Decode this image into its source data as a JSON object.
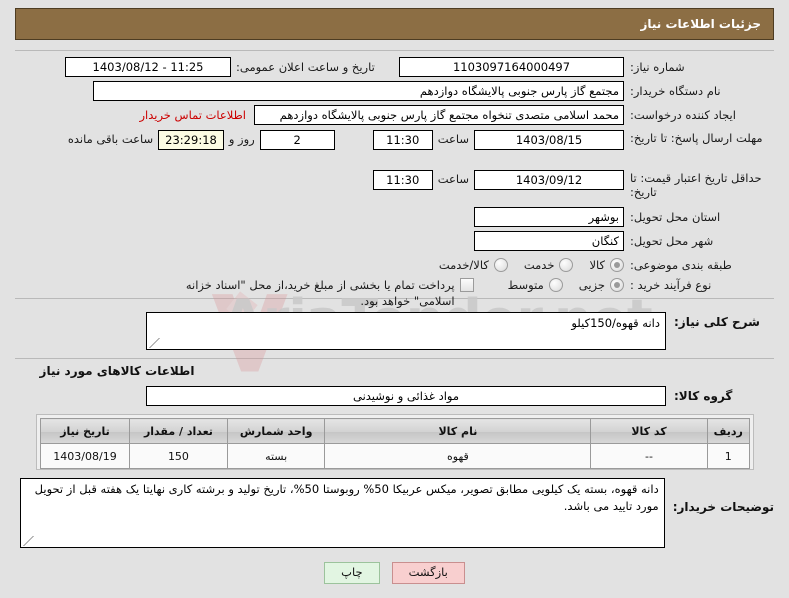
{
  "header": {
    "title": "جزئیات اطلاعات نیاز"
  },
  "watermark": {
    "text": "AriaTender.net"
  },
  "form": {
    "need_number": {
      "label": "شماره نیاز:",
      "value": "1103097164000497"
    },
    "public_announce": {
      "label": "تاریخ و ساعت اعلان عمومی:",
      "value": "11:25 - 1403/08/12"
    },
    "buyer_org": {
      "label": "نام دستگاه خریدار:",
      "value": "مجتمع گاز پارس جنوبی  پالایشگاه دوازدهم"
    },
    "requester": {
      "label": "ایجاد کننده درخواست:",
      "value": "محمد اسلامی متصدی تنخواه مجتمع گاز پارس جنوبی  پالایشگاه دوازدهم"
    },
    "buyer_contact_link": "اطلاعات تماس خریدار",
    "answer_deadline": {
      "label": "مهلت ارسال پاسخ: تا تاریخ:",
      "date": "1403/08/15",
      "time_label": "ساعت",
      "time": "11:30",
      "days": "2",
      "days_label": "روز و",
      "countdown": "23:29:18",
      "remaining_label": "ساعت باقی مانده"
    },
    "price_validity": {
      "label": "حداقل تاریخ اعتبار قیمت: تا تاریخ:",
      "date": "1403/09/12",
      "time_label": "ساعت",
      "time": "11:30"
    },
    "delivery_province": {
      "label": "استان محل تحویل:",
      "value": "بوشهر"
    },
    "delivery_city": {
      "label": "شهر محل تحویل:",
      "value": "کنگان"
    },
    "subject_category": {
      "label": "طبقه بندی موضوعی:",
      "options": [
        {
          "text": "کالا",
          "selected": true
        },
        {
          "text": "خدمت",
          "selected": false
        },
        {
          "text": "کالا/خدمت",
          "selected": false
        }
      ]
    },
    "purchase_process": {
      "label": "نوع فرآیند خرید :",
      "options": [
        {
          "text": "جزیی",
          "selected": true
        },
        {
          "text": "متوسط",
          "selected": false
        }
      ],
      "checkbox": {
        "text": "پرداخت تمام یا بخشی از مبلغ خرید،از محل \"اسناد خزانه اسلامی\" خواهد بود.",
        "checked": false
      }
    }
  },
  "description": {
    "label": "شرح کلی نیاز:",
    "value": "دانه قهوه/150کیلو"
  },
  "goods_section": {
    "heading": "اطلاعات کالاهای مورد نیاز",
    "group_label": "گروه کالا:",
    "group_value": "مواد غذائی و نوشیدنی",
    "table": {
      "columns": [
        "ردیف",
        "کد کالا",
        "نام کالا",
        "واحد شمارش",
        "تعداد / مقدار",
        "تاریخ نیاز"
      ],
      "rows": [
        [
          "1",
          "--",
          "قهوه",
          "بسته",
          "150",
          "1403/08/19"
        ]
      ]
    }
  },
  "buyer_notes": {
    "label": "توضیحات خریدار:",
    "value": "دانه قهوه، بسته یک کیلویی مطابق تصویر، میکس عربیکا 50% روبوستا 50%، تاریخ تولید و برشته کاری نهایتا یک هفته قبل از تحویل مورد تایید می باشد."
  },
  "buttons": {
    "back": "بازگشت",
    "print": "چاپ"
  },
  "colors": {
    "header_bg": "#8c6e44",
    "link_red": "#cc0000",
    "countdown_bg": "#fbfbe3",
    "back_btn_bg": "#f8cfcf",
    "print_btn_bg": "#e2f5e2"
  }
}
